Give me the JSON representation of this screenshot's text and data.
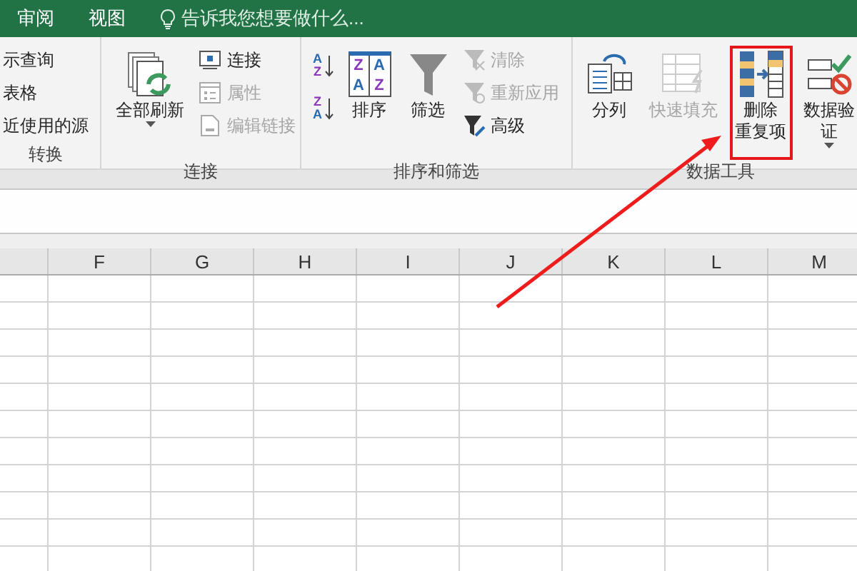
{
  "tabs": [
    {
      "label": "审阅",
      "selected": false
    },
    {
      "label": "视图",
      "selected": false
    }
  ],
  "tell_me": {
    "placeholder": "告诉我您想要做什么..."
  },
  "ribbon": {
    "groups": [
      {
        "label": "转换",
        "columns": [
          {
            "kind": "stack",
            "items": [
              {
                "label": "示查询",
                "disabled": false
              },
              {
                "label": "表格",
                "disabled": false
              },
              {
                "label": "近使用的源",
                "disabled": false
              }
            ]
          }
        ]
      },
      {
        "label": "连接",
        "columns": [
          {
            "kind": "large",
            "lines": [
              "全部刷新"
            ],
            "disabled": false,
            "caret": true,
            "highlighted": false
          },
          {
            "kind": "stack",
            "items": [
              {
                "label": "连接",
                "disabled": false
              },
              {
                "label": "属性",
                "disabled": true
              },
              {
                "label": "编辑链接",
                "disabled": true
              }
            ]
          }
        ]
      },
      {
        "label": "排序和筛选",
        "columns": [
          {
            "kind": "iconstack",
            "items": [
              {
                "letters": [
                  "A",
                  "Z"
                ],
                "disabled": false
              },
              {
                "letters": [
                  "Z",
                  "A"
                ],
                "disabled": false
              }
            ]
          },
          {
            "kind": "large",
            "lines": [
              "排序"
            ],
            "icon_letters": [
              "Z",
              "A",
              "A",
              "Z"
            ],
            "disabled": false,
            "caret": false,
            "highlighted": false
          },
          {
            "kind": "large",
            "lines": [
              "筛选"
            ],
            "disabled": false,
            "caret": false,
            "highlighted": false
          },
          {
            "kind": "stack",
            "items": [
              {
                "label": "清除",
                "disabled": true
              },
              {
                "label": "重新应用",
                "disabled": true
              },
              {
                "label": "高级",
                "disabled": false
              }
            ]
          }
        ]
      },
      {
        "label": "数据工具",
        "columns": [
          {
            "kind": "large",
            "lines": [
              "分列"
            ],
            "disabled": false,
            "caret": false,
            "highlighted": false
          },
          {
            "kind": "large",
            "lines": [
              "快速填充"
            ],
            "disabled": true,
            "caret": false,
            "highlighted": false
          },
          {
            "kind": "large",
            "lines": [
              "删除",
              "重复项"
            ],
            "disabled": false,
            "caret": false,
            "highlighted": true
          },
          {
            "kind": "large",
            "lines": [
              "数据验",
              "证"
            ],
            "disabled": false,
            "caret": true,
            "highlighted": false
          }
        ]
      }
    ]
  },
  "sheet": {
    "columns": [
      "F",
      "G",
      "H",
      "I",
      "J",
      "K",
      "L",
      "M"
    ]
  }
}
